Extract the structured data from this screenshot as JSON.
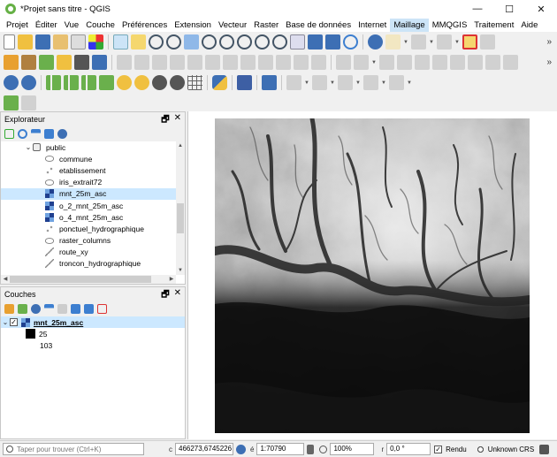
{
  "window": {
    "title": "*Projet sans titre - QGIS",
    "minimize": "—",
    "maximize": "☐",
    "close": "✕"
  },
  "menu": [
    "Projet",
    "Éditer",
    "Vue",
    "Couche",
    "Préférences",
    "Extension",
    "Vecteur",
    "Raster",
    "Base de données",
    "Internet",
    "Maillage",
    "MMQGIS",
    "Traitement",
    "Aide"
  ],
  "menu_active": "Maillage",
  "toolbar_more": "»",
  "browser_panel": {
    "title": "Explorateur",
    "float_icon": "🗗",
    "close_icon": "✕",
    "items": [
      {
        "label": "public",
        "type": "schema",
        "indent": 1,
        "expanded": true
      },
      {
        "label": "commune",
        "type": "table",
        "indent": 2
      },
      {
        "label": "etablissement",
        "type": "points",
        "indent": 2
      },
      {
        "label": "iris_extrait72",
        "type": "table",
        "indent": 2
      },
      {
        "label": "mnt_25m_asc",
        "type": "raster",
        "indent": 2,
        "selected": true
      },
      {
        "label": "o_2_mnt_25m_asc",
        "type": "raster",
        "indent": 2
      },
      {
        "label": "o_4_mnt_25m_asc",
        "type": "raster",
        "indent": 2
      },
      {
        "label": "ponctuel_hydrographique",
        "type": "points",
        "indent": 2
      },
      {
        "label": "raster_columns",
        "type": "table",
        "indent": 2
      },
      {
        "label": "route_xy",
        "type": "line",
        "indent": 2
      },
      {
        "label": "troncon_hydrographique",
        "type": "line",
        "indent": 2
      }
    ]
  },
  "layers_panel": {
    "title": "Couches",
    "float_icon": "🗗",
    "close_icon": "✕",
    "layer": {
      "name": "mnt_25m_asc",
      "checked": true
    },
    "legend": {
      "max": "25",
      "min": "103"
    }
  },
  "statusbar": {
    "search_placeholder": "Taper pour trouver (Ctrl+K)",
    "coord_label": "c",
    "coordinate": "466273,6745226",
    "scale_label": "é",
    "scale": "1:70790",
    "magnifier": "100%",
    "rotation_label": "r",
    "rotation": "0,0 °",
    "render_label": "Rendu",
    "crs": "Unknown CRS"
  }
}
